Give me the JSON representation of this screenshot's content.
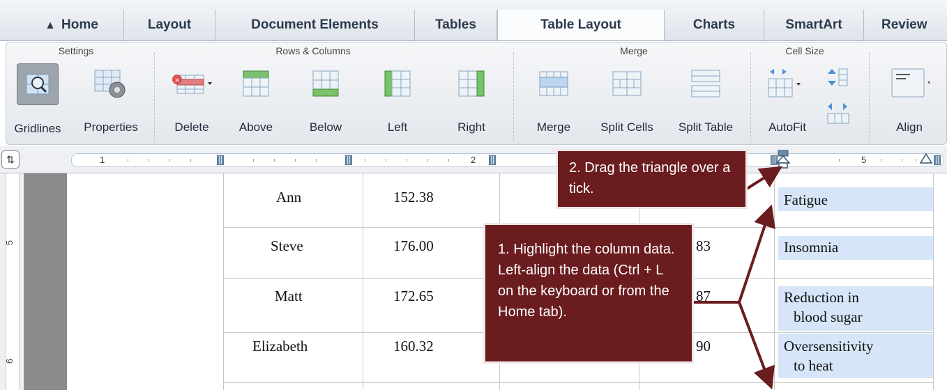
{
  "tabs": {
    "home": "Home",
    "layout": "Layout",
    "document_elements": "Document Elements",
    "tables": "Tables",
    "table_layout": "Table Layout",
    "charts": "Charts",
    "smartart": "SmartArt",
    "review": "Review"
  },
  "ribbon": {
    "groups": {
      "settings": "Settings",
      "rows_columns": "Rows & Columns",
      "merge": "Merge",
      "cell_size": "Cell Size"
    },
    "buttons": {
      "gridlines": "Gridlines",
      "properties": "Properties",
      "delete": "Delete",
      "above": "Above",
      "below": "Below",
      "left": "Left",
      "right": "Right",
      "merge": "Merge",
      "split_cells": "Split Cells",
      "split_table": "Split Table",
      "autofit": "AutoFit",
      "align": "Align"
    }
  },
  "ruler": {
    "numbers": [
      "1",
      "2",
      "5"
    ],
    "vertical_numbers": [
      "5",
      "6"
    ]
  },
  "table": {
    "rows": [
      {
        "name": "Ann",
        "value": "152.38",
        "col4": "",
        "note": "Fatigue",
        "note2": ""
      },
      {
        "name": "Steve",
        "value": "176.00",
        "col4": "83",
        "note": "Insomnia",
        "note2": ""
      },
      {
        "name": "Matt",
        "value": "172.65",
        "col4": "87",
        "note": "Reduction in",
        "note2": "blood sugar"
      },
      {
        "name": "Elizabeth",
        "value": "160.32",
        "col4": "90",
        "note": "Oversensitivity",
        "note2": "to heat"
      }
    ]
  },
  "callouts": {
    "step2": "2. Drag the triangle over a tick.",
    "step1": "1. Highlight the column data. Left-align the data (Ctrl + L on the keyboard or from the Home tab)."
  },
  "colors": {
    "callout_bg": "#6a1c1f",
    "highlight": "#d6e6f8"
  }
}
